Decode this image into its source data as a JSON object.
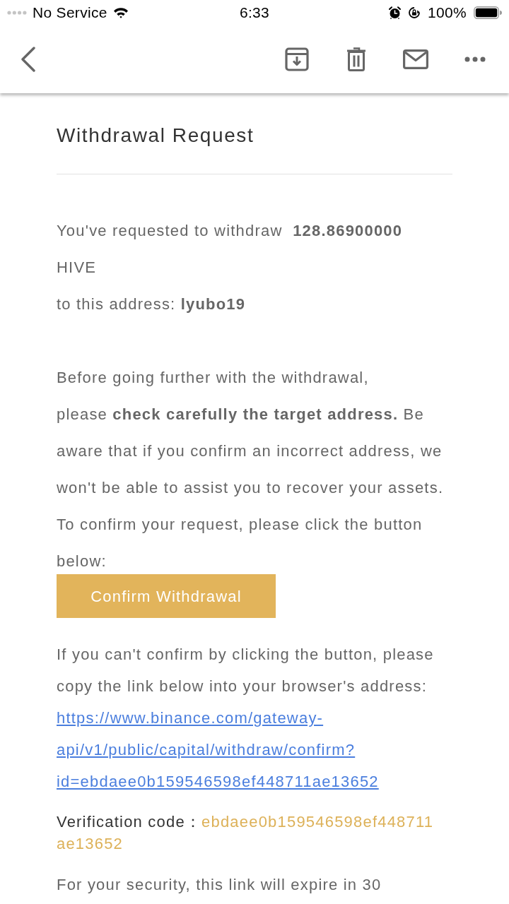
{
  "status_bar": {
    "carrier": "No Service",
    "time": "6:33",
    "battery": "100%"
  },
  "message": {
    "title": "Withdrawal Request",
    "request": "You've requested to withdraw  **128.86900000** HIVE\nto this address: **lyubo19**",
    "warning": "Before going further with the withdrawal,\nplease **check carefully the target address.** Be aware that if you confirm an incorrect address, we won't be able to assist you to recover your assets. To confirm your request, please click the button below:",
    "confirm_button": "Confirm Withdrawal",
    "fallback": "If you can't confirm by clicking the button, please copy the link below into your browser's address:",
    "confirm_link": "https://www.binance.com/gateway-api/v1/public/capital/withdraw/confirm?id=ebdaee0b159546598ef448711ae13652",
    "verification_label": "Verification code：",
    "verification_code": "ebdaee0b159546598ef448711ae13652",
    "expiry_notice": "For your security, this link will expire in 30"
  }
}
